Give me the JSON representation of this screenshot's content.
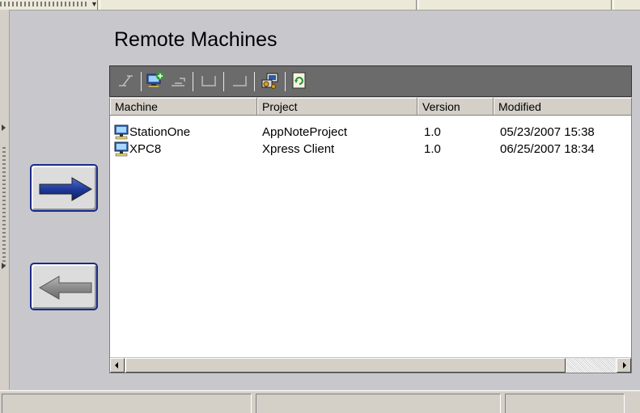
{
  "window": {
    "title": "Remote Machines"
  },
  "toolbar": {
    "buttons": [
      {
        "icon": "disconnect-icon",
        "enabled": false
      },
      {
        "icon": "add-machine-icon",
        "enabled": true
      },
      {
        "icon": "remove-machine-icon",
        "enabled": false
      },
      {
        "icon": "blank-icon-1",
        "enabled": false
      },
      {
        "icon": "blank-icon-2",
        "enabled": false
      },
      {
        "icon": "transfer-icon",
        "enabled": true
      },
      {
        "icon": "refresh-icon",
        "enabled": true
      }
    ]
  },
  "list": {
    "columns": [
      "Machine",
      "Project",
      "Version",
      "Modified"
    ],
    "rows": [
      {
        "machine": "StationOne",
        "project": "AppNoteProject",
        "version": "1.0",
        "modified": "05/23/2007 15:38"
      },
      {
        "machine": "XPC8",
        "project": "Xpress Client",
        "version": "1.0",
        "modified": "06/25/2007 18:34"
      }
    ]
  },
  "buttons": {
    "send": {
      "icon": "arrow-right-icon",
      "color": "#1f3a9a"
    },
    "receive": {
      "icon": "arrow-left-icon",
      "color": "#8c8c8c"
    }
  },
  "statusbar": {
    "panes": [
      "",
      "",
      ""
    ]
  },
  "colors": {
    "toolbar": "#6b6b6b",
    "panel": "#c8c8cc",
    "accent_border": "#1a2a8a"
  }
}
